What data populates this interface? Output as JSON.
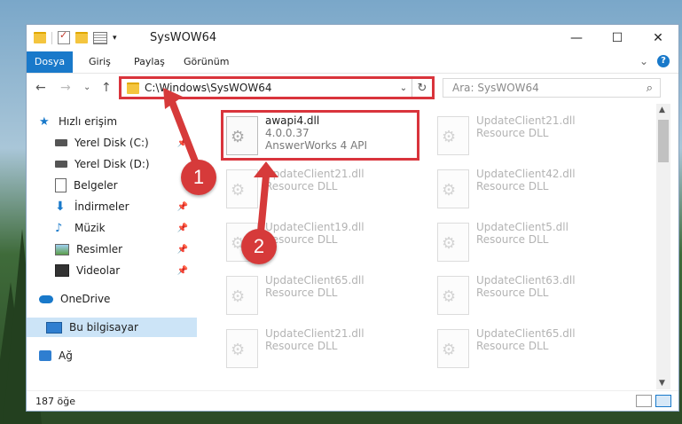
{
  "window": {
    "title": "SysWOW64",
    "controls": {
      "minimize": "—",
      "maximize": "☐",
      "close": "✕"
    }
  },
  "menu": {
    "file": "Dosya",
    "home": "Giriş",
    "share": "Paylaş",
    "view": "Görünüm",
    "expand": "⌄",
    "help": "?"
  },
  "nav": {
    "back": "←",
    "forward": "→",
    "recent": "⌄",
    "up": "↑",
    "address": "C:\\Windows\\SysWOW64",
    "dropdown": "⌄",
    "refresh": "↻",
    "search_placeholder": "Ara: SysWOW64",
    "search_icon": "⌕"
  },
  "sidebar": {
    "items": [
      {
        "label": "Hızlı erişim",
        "icon": "star-icon"
      },
      {
        "label": "Yerel Disk (C:)",
        "icon": "drive-icon",
        "pinned": true
      },
      {
        "label": "Yerel Disk (D:)",
        "icon": "drive-icon"
      },
      {
        "label": "Belgeler",
        "icon": "documents-icon"
      },
      {
        "label": "İndirmeler",
        "icon": "downloads-icon",
        "pinned": true
      },
      {
        "label": "Müzik",
        "icon": "music-icon",
        "pinned": true
      },
      {
        "label": "Resimler",
        "icon": "pictures-icon",
        "pinned": true
      },
      {
        "label": "Videolar",
        "icon": "videos-icon",
        "pinned": true
      },
      {
        "label": "OneDrive",
        "icon": "onedrive-icon"
      },
      {
        "label": "Bu bilgisayar",
        "icon": "this-pc-icon",
        "selected": true
      },
      {
        "label": "Ağ",
        "icon": "network-icon"
      }
    ],
    "pin_glyph": "📌"
  },
  "files": [
    {
      "name": "awapi4.dll",
      "line1": "4.0.0.37",
      "line2": "AnswerWorks 4 API",
      "highlight": true
    },
    {
      "name": "UpdateClient21.dll",
      "line1": "Resource DLL"
    },
    {
      "name": "UpdateClient21.dll",
      "line1": "Resource DLL"
    },
    {
      "name": "UpdateClient42.dll",
      "line1": "Resource DLL"
    },
    {
      "name": "UpdateClient19.dll",
      "line1": "Resource DLL"
    },
    {
      "name": "UpdateClient5.dll",
      "line1": "Resource DLL"
    },
    {
      "name": "UpdateClient65.dll",
      "line1": "Resource DLL"
    },
    {
      "name": "UpdateClient63.dll",
      "line1": "Resource DLL"
    },
    {
      "name": "UpdateClient21.dll",
      "line1": "Resource DLL"
    },
    {
      "name": "UpdateClient65.dll",
      "line1": "Resource DLL"
    }
  ],
  "status": {
    "count": "187 öğe"
  },
  "markers": {
    "one": "1",
    "two": "2"
  },
  "colors": {
    "accent": "#1979ca",
    "annotation": "#d63a3a"
  }
}
